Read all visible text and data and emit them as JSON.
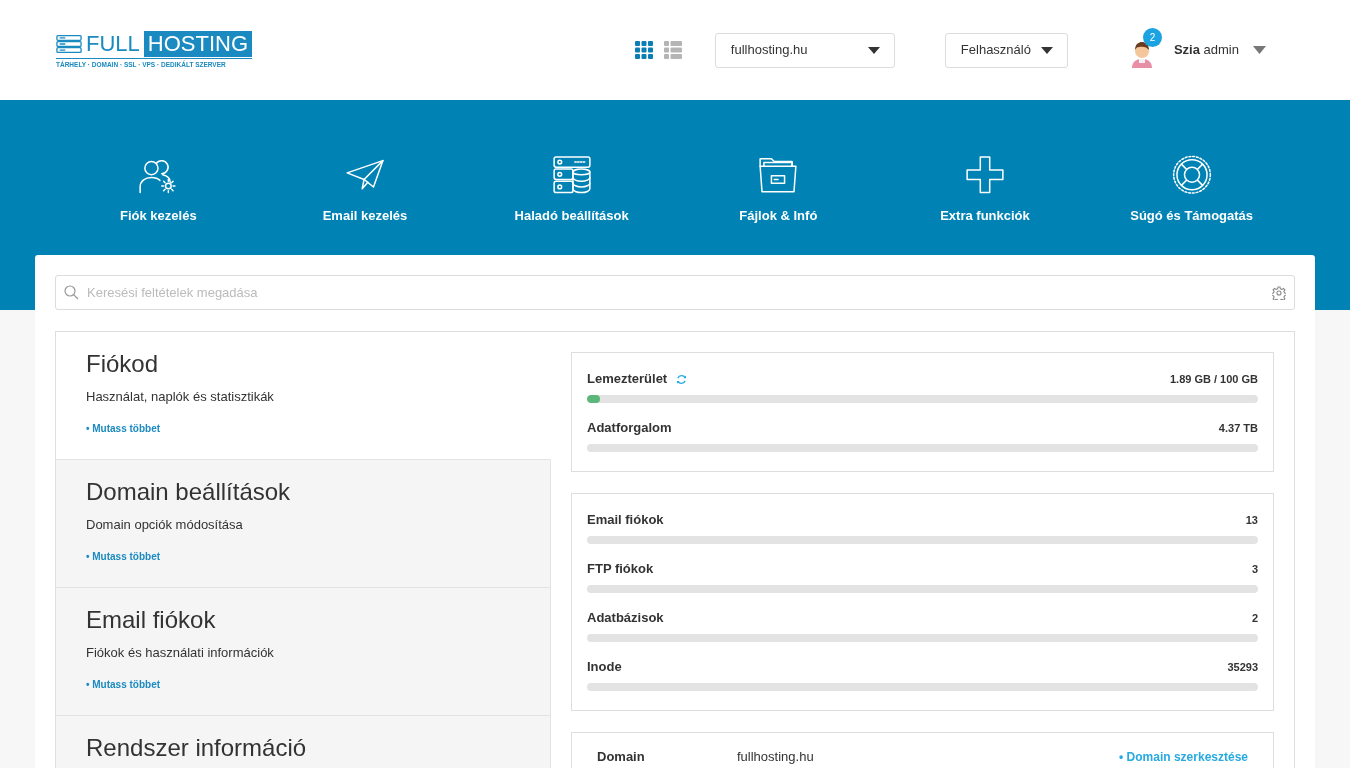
{
  "header": {
    "logo": {
      "text_1": "FULL",
      "text_2": "HOSTING",
      "tagline": "TÁRHELY · DOMAIN · SSL · VPS · DEDIKÁLT SZERVER"
    },
    "view_toggle": [
      {
        "kind": "grid",
        "selected": true
      },
      {
        "kind": "list",
        "selected": false
      }
    ],
    "domain_select": {
      "value": "fullhosting.hu"
    },
    "role_select": {
      "value": "Felhasználó"
    },
    "user": {
      "notifications": "2",
      "greeting": "**Szia** admin"
    }
  },
  "nav": [
    {
      "kind": "users",
      "label": "Fiók kezelés"
    },
    {
      "kind": "plane",
      "label": "Email kezelés"
    },
    {
      "kind": "server",
      "label": "Haladó beállítások"
    },
    {
      "kind": "folder",
      "label": "Fájlok & Infó"
    },
    {
      "kind": "plus",
      "label": "Extra funkciók"
    },
    {
      "kind": "lifebuoy",
      "label": "Súgó és Támogatás"
    }
  ],
  "search": {
    "placeholder": "Keresési feltételek megadása"
  },
  "sections": [
    {
      "title": "Fiókod",
      "description": "Használat, naplók és statisztikák",
      "link": "• Mutass többet",
      "selected": true
    },
    {
      "title": "Domain beállítások",
      "description": "Domain opciók módosítása",
      "link": "• Mutass többet",
      "selected": false
    },
    {
      "title": "Email fiókok",
      "description": "Fiókok és használati információk",
      "link": "• Mutass többet",
      "selected": false
    },
    {
      "title": "Rendszer információ",
      "selected": false
    }
  ],
  "usage_groups": [
    [
      {
        "label": "Lemezterület",
        "refresh": true,
        "value": "1.89 GB / 100 GB",
        "level": 0.019
      },
      {
        "label": "Adatforgalom",
        "refresh": false,
        "value": "4.37 TB"
      }
    ],
    [
      {
        "label": "Email fiókok",
        "refresh": false,
        "value": "13"
      },
      {
        "label": "FTP fiókok",
        "refresh": false,
        "value": "3"
      },
      {
        "label": "Adatbázisok",
        "refresh": false,
        "value": "2"
      },
      {
        "label": "Inode",
        "refresh": false,
        "value": "35293"
      }
    ]
  ],
  "domain_row": {
    "label": "Domain",
    "value": "fullhosting.hu",
    "link": "• Domain szerkesztése"
  }
}
